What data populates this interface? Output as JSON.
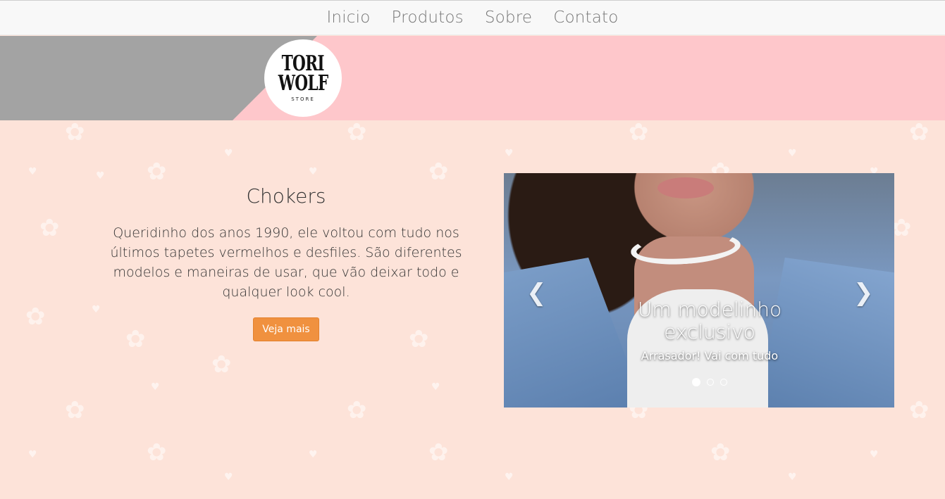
{
  "nav": {
    "items": [
      {
        "label": "Inicio"
      },
      {
        "label": "Produtos"
      },
      {
        "label": "Sobre"
      },
      {
        "label": "Contato"
      }
    ]
  },
  "logo": {
    "line1": "TORI",
    "line2": "WOLF",
    "sub": "STORE"
  },
  "feature": {
    "title": "Chokers",
    "description": "Queridinho dos anos 1990, ele voltou com tudo nos últimos tapetes vermelhos e desfiles. São diferentes modelos e maneiras de usar, que vão deixar todo e qualquer look cool.",
    "button_label": "Veja mais"
  },
  "carousel": {
    "caption_title": "Um modelinho exclusivo",
    "caption_sub": "Arrasador! Vai com tudo",
    "prev_icon": "chevron-left-icon",
    "next_icon": "chevron-right-icon",
    "slides_count": 3,
    "active_slide": 1
  },
  "colors": {
    "background": "#fde3d9",
    "banner_pink": "#fec7cb",
    "banner_grey": "#a3a3a3",
    "accent_button": "#f0913f"
  }
}
